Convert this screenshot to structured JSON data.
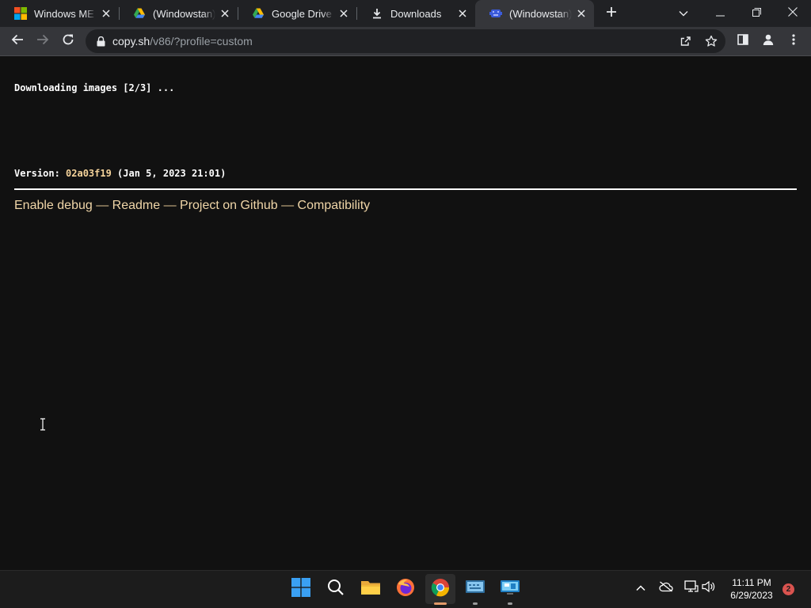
{
  "browser": {
    "tabs": [
      {
        "title": "Windows ME ISO",
        "favicon": "windows-logo-icon",
        "active": false
      },
      {
        "title": "(Windowstan) W",
        "favicon": "google-drive-icon",
        "active": false
      },
      {
        "title": "Google Drive - V",
        "favicon": "google-drive-icon",
        "active": false
      },
      {
        "title": "Downloads",
        "favicon": "download-icon",
        "active": false
      },
      {
        "title": "(Windowstan) W",
        "favicon": "v86-icon",
        "active": true
      }
    ],
    "address_bar": {
      "host": "copy.sh",
      "path": "/v86/?profile=custom"
    }
  },
  "page": {
    "status_text": "Downloading images [2/3] ...",
    "version_prefix": "Version: ",
    "version_hash": "02a03f19",
    "version_suffix": " (Jan 5, 2023 21:01)",
    "links": [
      {
        "label": "Enable debug"
      },
      {
        "label": "Readme"
      },
      {
        "label": "Project on Github"
      },
      {
        "label": "Compatibility"
      }
    ],
    "separator": " — "
  },
  "taskbar": {
    "apps": [
      {
        "name": "start-button",
        "icon": "windows-start-icon"
      },
      {
        "name": "search-button",
        "icon": "search-icon"
      },
      {
        "name": "file-explorer",
        "icon": "folder-icon"
      },
      {
        "name": "firefox",
        "icon": "firefox-icon"
      },
      {
        "name": "chrome",
        "icon": "chrome-icon",
        "active": true
      },
      {
        "name": "app-keyboard",
        "icon": "keyboard-app-icon"
      },
      {
        "name": "app-monitor",
        "icon": "monitor-app-icon"
      }
    ],
    "clock": {
      "time": "11:11 PM",
      "date": "6/29/2023"
    },
    "notification_count": "2"
  },
  "colors": {
    "page_bg": "#111111",
    "accent_link": "#f0d6a8",
    "hash": "#f5d39a",
    "tab_active": "#35363a",
    "tabstrip": "#202124"
  }
}
